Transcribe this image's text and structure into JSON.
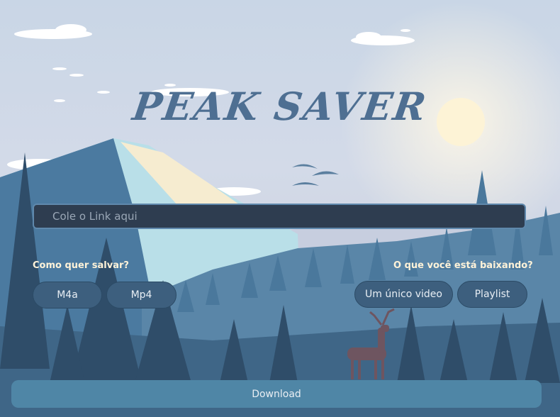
{
  "app": {
    "title": "PEAK SAVER"
  },
  "link_input": {
    "placeholder": "Cole o Link aqui",
    "value": ""
  },
  "format_section": {
    "label": "Como quer salvar?",
    "options": [
      "M4a",
      "Mp4"
    ]
  },
  "type_section": {
    "label": "O que você está baixando?",
    "options": [
      "Um único video",
      "Playlist"
    ]
  },
  "download_label": "Download",
  "colors": {
    "accent": "#4f86a6",
    "input_bg": "#2e3d50",
    "button_bg": "#3d5f7e",
    "label_text": "#fff3d9",
    "title_text": "#4e6f92"
  }
}
